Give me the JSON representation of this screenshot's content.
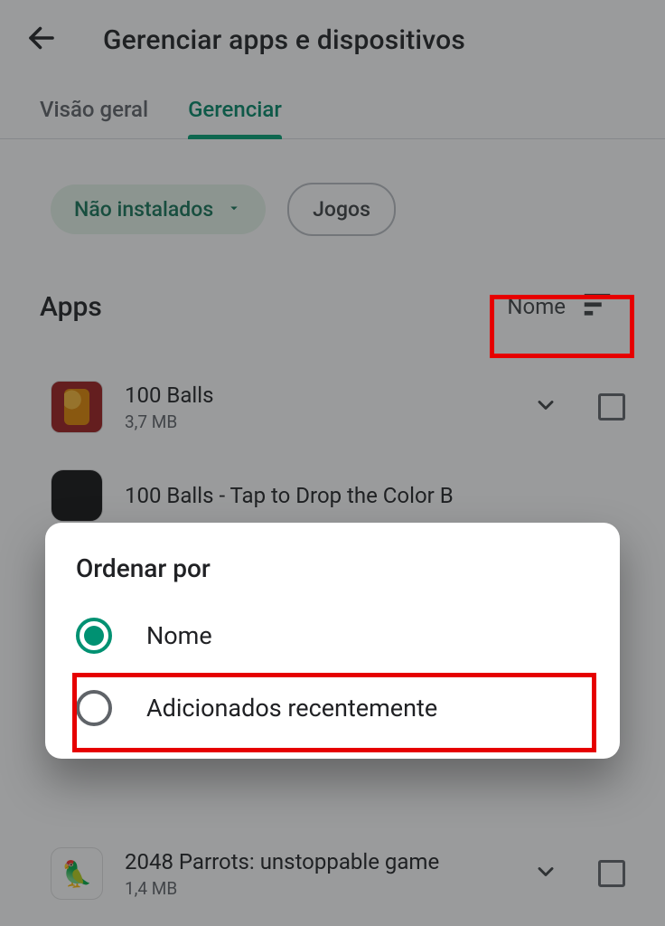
{
  "header": {
    "title": "Gerenciar apps e dispositivos"
  },
  "tabs": [
    {
      "label": "Visão geral",
      "active": false
    },
    {
      "label": "Gerenciar",
      "active": true
    }
  ],
  "filters": {
    "installed_chip": "Não instalados",
    "games_chip": "Jogos"
  },
  "section": {
    "title": "Apps",
    "sort_label": "Nome"
  },
  "apps": [
    {
      "name": "100 Balls",
      "size": "3,7 MB"
    },
    {
      "name": "100 Balls - Tap to Drop the Color B",
      "size": ""
    },
    {
      "name": "2048 Parrots: unstoppable game",
      "size": "1,4 MB"
    }
  ],
  "dialog": {
    "title": "Ordenar por",
    "options": [
      {
        "label": "Nome",
        "selected": true
      },
      {
        "label": "Adicionados recentemente",
        "selected": false
      }
    ]
  }
}
